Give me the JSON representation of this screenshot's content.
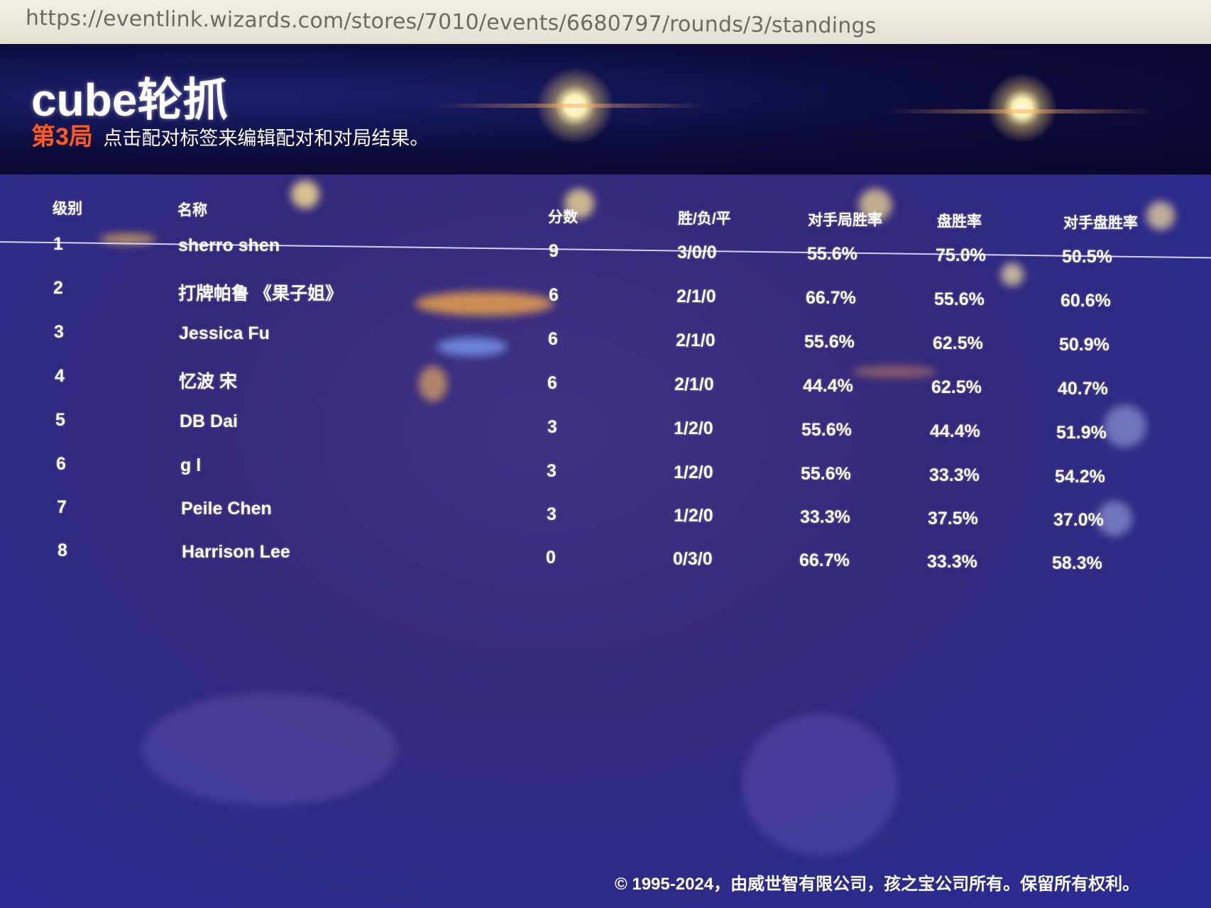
{
  "browser": {
    "url": "https://eventlink.wizards.com/stores/7010/events/6680797/rounds/3/standings"
  },
  "header": {
    "title": "cube轮抓",
    "round_label": "第3局",
    "hint": "点击配对标签来编辑配对和对局结果。"
  },
  "table": {
    "columns": [
      "级别",
      "名称",
      "分数",
      "胜/负/平",
      "对手局胜率",
      "盘胜率",
      "对手盘胜率"
    ],
    "rows": [
      [
        "1",
        "sherro shen",
        "9",
        "3/0/0",
        "55.6%",
        "75.0%",
        "50.5%"
      ],
      [
        "2",
        "打牌帕鲁 《果子姐》",
        "6",
        "2/1/0",
        "66.7%",
        "55.6%",
        "60.6%"
      ],
      [
        "3",
        "Jessica Fu",
        "6",
        "2/1/0",
        "55.6%",
        "62.5%",
        "50.9%"
      ],
      [
        "4",
        "忆波 宋",
        "6",
        "2/1/0",
        "44.4%",
        "62.5%",
        "40.7%"
      ],
      [
        "5",
        "DB Dai",
        "3",
        "1/2/0",
        "55.6%",
        "44.4%",
        "51.9%"
      ],
      [
        "6",
        "g l",
        "3",
        "1/2/0",
        "55.6%",
        "33.3%",
        "54.2%"
      ],
      [
        "7",
        "Peile Chen",
        "3",
        "1/2/0",
        "33.3%",
        "37.5%",
        "37.0%"
      ],
      [
        "8",
        "Harrison Lee",
        "0",
        "0/3/0",
        "66.7%",
        "33.3%",
        "58.3%"
      ]
    ]
  },
  "footer": {
    "copyright": "© 1995-2024，由威世智有限公司，孩之宝公司所有。保留所有权利。"
  },
  "colors": {
    "round_label": "#ff5a1f",
    "header_bg": "#0c0b3a",
    "main_bg": "#33297a"
  }
}
